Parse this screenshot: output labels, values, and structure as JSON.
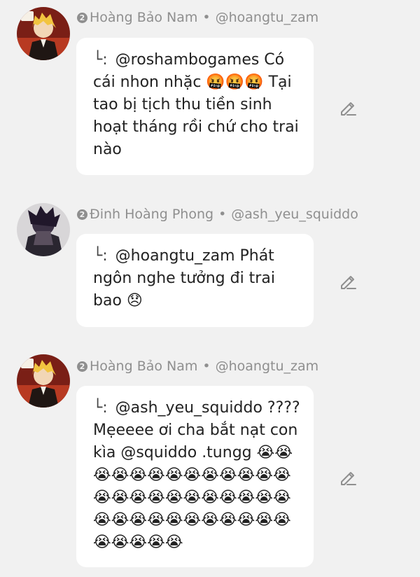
{
  "comments": [
    {
      "rank": "2",
      "name": "Hoàng Bảo Nam",
      "separator": "•",
      "handle": "@hoangtu_zam",
      "reply_prefix": "└:",
      "text": "@roshambogames Có cái nhon nhặc 🤬🤬🤬 Tại tao bị tịch thu tiền sinh hoạt tháng rồi chứ cho trai nào",
      "avatar_icon": "anime-avatar-icon"
    },
    {
      "rank": "2",
      "name": "Đinh Hoàng Phong",
      "separator": "•",
      "handle": "@ash_yeu_squiddo",
      "reply_prefix": "└:",
      "text": "@hoangtu_zam Phát ngôn nghe tưởng đi trai bao 😞",
      "avatar_icon": "dark-avatar-icon"
    },
    {
      "rank": "2",
      "name": "Hoàng Bảo Nam",
      "separator": "•",
      "handle": "@hoangtu_zam",
      "reply_prefix": "└:",
      "text": "@ash_yeu_squiddo ???? Mẹeeee ơi cha bắt nạt con kìa @squiddo .tungg 😭😭😭😭😭😭😭😭😭😭😭😭😭😭😭😭😭😭😭😭😭😭😭😭😭😭😭😭😭😭😭😭😭😭😭😭😭😭😭😭",
      "avatar_icon": "anime-avatar-icon"
    }
  ],
  "colors": {
    "background": "#f1f1f1",
    "bubble": "#ffffff",
    "meta_text": "#8f8f8f",
    "body_text": "#222222"
  }
}
